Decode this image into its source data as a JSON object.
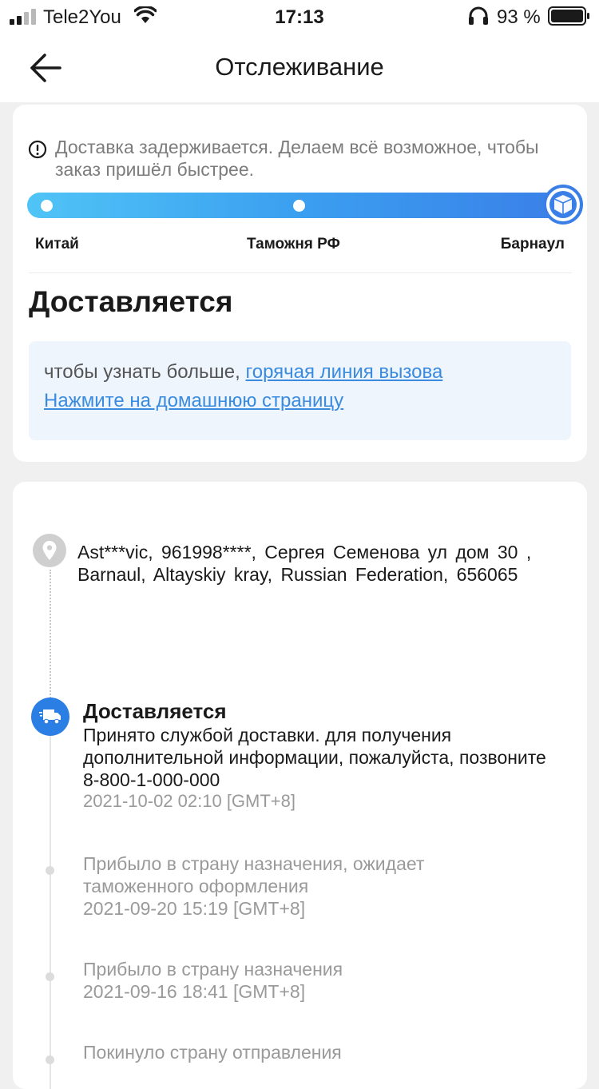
{
  "status_bar": {
    "carrier": "Tele2You",
    "time": "17:13",
    "battery": "93 %"
  },
  "nav": {
    "title": "Отслеживание",
    "back_icon": "arrow-left-icon"
  },
  "summary": {
    "warning": "Доставка задерживается. Делаем всё возможное, чтобы заказ пришёл быстрее.",
    "progress_stages": [
      "Китай",
      "Таможня РФ",
      "Барнаул"
    ],
    "progress_current_stage": 3,
    "status": "Доставляется",
    "info_prefix": "чтобы узнать больше, ",
    "info_link1": "горячая линия вызова",
    "info_link2": "Нажмите на домашнюю страницу"
  },
  "address": "Ast***vic,  961998****,  Сергея Семенова ул дом 30 ,  Barnaul,  Altayskiy kray,  Russian Federation,  656065",
  "events": [
    {
      "title": "Доставляется",
      "description": "Принято службой доставки. для получения дополнительной информации, пожалуйста, позвоните 8-800-1-000-000",
      "time": "2021-10-02 02:10 [GMT+8]"
    },
    {
      "description": "Прибыло в страну назначения, ожидает таможенного оформления",
      "time": "2021-09-20 15:19 [GMT+8]"
    },
    {
      "description": "Прибыло в страну назначения",
      "time": "2021-09-16 18:41 [GMT+8]"
    },
    {
      "description": "Покинуло страну отправления"
    }
  ],
  "colors": {
    "accent": "#3a7fe8",
    "progress_start": "#50c4f6",
    "link": "#3a8be0",
    "muted": "#9a9a9a"
  }
}
